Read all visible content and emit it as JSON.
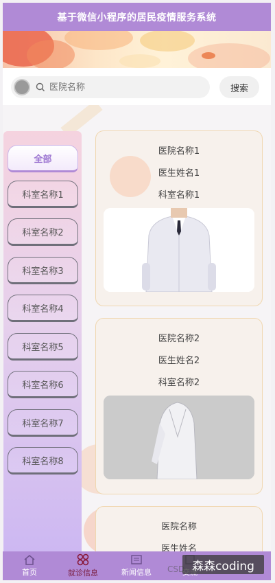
{
  "header": {
    "title": "基于微信小程序的居民疫情服务系统"
  },
  "search": {
    "placeholder": "医院名称",
    "button_label": "搜索"
  },
  "categories": [
    {
      "label": "全部",
      "active": true
    },
    {
      "label": "科室名称1"
    },
    {
      "label": "科室名称2"
    },
    {
      "label": "科室名称3"
    },
    {
      "label": "科室名称4"
    },
    {
      "label": "科室名称5"
    },
    {
      "label": "科室名称6"
    },
    {
      "label": "科室名称7"
    },
    {
      "label": "科室名称8"
    }
  ],
  "cards": [
    {
      "hospital": "医院名称1",
      "doctor": "医生姓名1",
      "department": "科室名称1"
    },
    {
      "hospital": "医院名称2",
      "doctor": "医生姓名2",
      "department": "科室名称2"
    },
    {
      "hospital": "医院名称",
      "doctor": "医生姓名"
    }
  ],
  "bottom_nav": [
    {
      "label": "首页",
      "icon": "home-icon"
    },
    {
      "label": "就诊信息",
      "icon": "clinic-icon",
      "active": true
    },
    {
      "label": "新闻信息",
      "icon": "news-icon"
    },
    {
      "label": "交流",
      "icon": "chat-icon"
    }
  ],
  "watermark": {
    "text": "森森coding",
    "csdn": "CSD"
  },
  "colors": {
    "primary": "#b08ad6",
    "active_nav": "#7a1c3e",
    "card_border": "#f0d7b0"
  }
}
